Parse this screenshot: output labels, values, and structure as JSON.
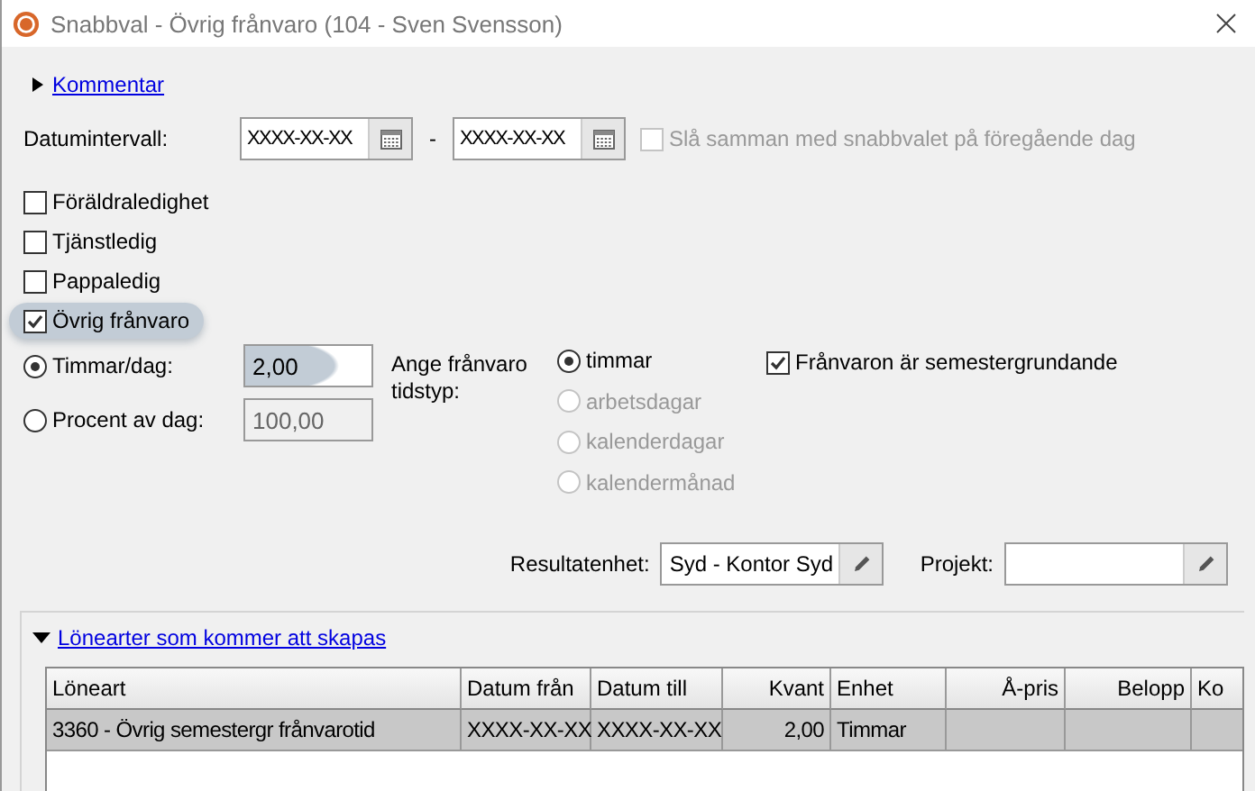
{
  "window": {
    "title": "Snabbval - Övrig frånvaro (104 - Sven Svensson)"
  },
  "comment": {
    "label": "Kommentar",
    "expanded": false
  },
  "date_range": {
    "label": "Datumintervall:",
    "from": "XXXX-XX-XX",
    "separator": "-",
    "to": "XXXX-XX-XX",
    "merge": {
      "label": "Slå samman med snabbvalet på föregående dag",
      "checked": false,
      "disabled": true
    }
  },
  "absence_types": [
    {
      "label": "Föräldraledighet",
      "checked": false,
      "highlighted": false
    },
    {
      "label": "Tjänstledig",
      "checked": false,
      "highlighted": false
    },
    {
      "label": "Pappaledig",
      "checked": false,
      "highlighted": false
    },
    {
      "label": "Övrig frånvaro",
      "checked": true,
      "highlighted": true
    }
  ],
  "amount_modes": [
    {
      "label": "Timmar/dag:",
      "selected": true,
      "value": "2,00",
      "disabled": false,
      "highlighted": true
    },
    {
      "label": "Procent av dag:",
      "selected": false,
      "value": "100,00",
      "disabled": true,
      "highlighted": false
    }
  ],
  "time_type": {
    "label": "Ange frånvaro tidstyp:",
    "options": [
      {
        "label": "timmar",
        "selected": true,
        "disabled": false
      },
      {
        "label": "arbetsdagar",
        "selected": false,
        "disabled": true
      },
      {
        "label": "kalenderdagar",
        "selected": false,
        "disabled": true
      },
      {
        "label": "kalendermånad",
        "selected": false,
        "disabled": true
      }
    ]
  },
  "vacation_basis": {
    "label": "Frånvaron är semestergrundande",
    "checked": true
  },
  "result_unit": {
    "label": "Resultatenhet:",
    "value": "Syd - Kontor Syd"
  },
  "project": {
    "label": "Projekt:"
  },
  "salary_types": {
    "title": "Lönearter som kommer att skapas",
    "expanded": true,
    "columns": [
      {
        "label": "Löneart",
        "numeric": false
      },
      {
        "label": "Datum från",
        "numeric": false
      },
      {
        "label": "Datum till",
        "numeric": false
      },
      {
        "label": "Kvant",
        "numeric": true
      },
      {
        "label": "Enhet",
        "numeric": false
      },
      {
        "label": "Å-pris",
        "numeric": true
      },
      {
        "label": "Belopp",
        "numeric": true
      },
      {
        "label": "Ko",
        "numeric": false
      }
    ],
    "rows": [
      {
        "selected": true,
        "cells": [
          "3360 - Övrig semestergr frånvarotid",
          "XXXX-XX-XX",
          "XXXX-XX-XX",
          "2,00",
          "Timmar",
          "",
          "",
          ""
        ]
      }
    ]
  }
}
